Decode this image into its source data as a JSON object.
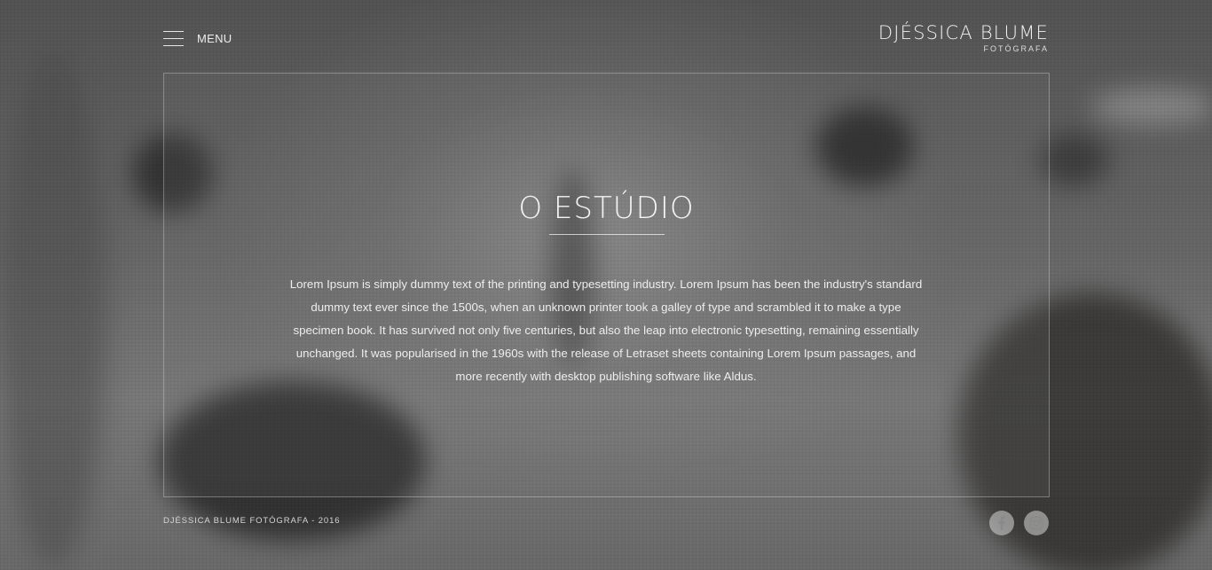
{
  "header": {
    "menu_label": "MENU",
    "logo": {
      "name": "DJÉSSICA BLUME",
      "subtitle": "FOTÓGRAFA"
    }
  },
  "main": {
    "title": "O ESTÚDIO",
    "body": "Lorem Ipsum is simply dummy text of the printing and typesetting industry. Lorem Ipsum has been the industry's standard dummy text ever since the 1500s, when an unknown printer took a galley of type and scrambled it to make a type specimen book. It has survived not only five centuries, but also the leap into electronic typesetting, remaining essentially unchanged. It was popularised in the 1960s with the release of Letraset sheets containing Lorem Ipsum passages, and more recently with desktop publishing software like Aldus."
  },
  "footer": {
    "copyright": "DJÉSSICA BLUME FOTÓGRAFA - 2016",
    "social": [
      {
        "icon": "facebook-icon"
      },
      {
        "icon": "instagram-icon"
      }
    ]
  },
  "colors": {
    "text": "#f0f0f0",
    "frame_border": "#e6e6e6"
  }
}
